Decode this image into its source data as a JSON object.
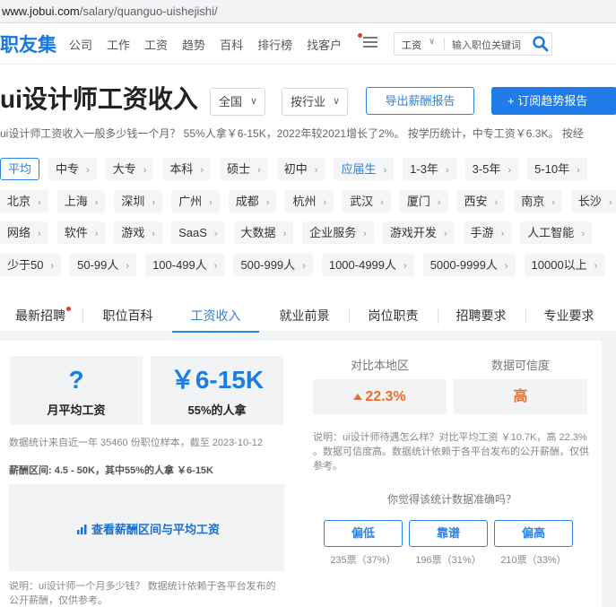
{
  "browser": {
    "url_host": "www.jobui.com",
    "url_path": "/salary/quanguo-uishejishi/"
  },
  "nav": {
    "logo": "职友集",
    "links": [
      "公司",
      "工作",
      "工资",
      "趋势",
      "百科",
      "排行榜",
      "找客户"
    ],
    "search_type": "工资",
    "search_placeholder": "输入职位关键词"
  },
  "header": {
    "title": "ui设计师工资收入",
    "region": "全国",
    "industry": "按行业",
    "export_label": "导出薪酬报告",
    "subscribe_label": "+ 订阅趋势报告",
    "summary": "ui设计师工资收入一般多少钱一个月？ 55%人拿￥6-15K，2022年较2021增长了2%。 按学历统计，中专工资￥6.3K。 按经"
  },
  "filters": {
    "education": [
      {
        "label": "平均",
        "active": true
      },
      {
        "label": "中专"
      },
      {
        "label": "大专"
      },
      {
        "label": "本科"
      },
      {
        "label": "硕士"
      },
      {
        "label": "初中"
      },
      {
        "label": "应届生",
        "highlight": true
      },
      {
        "label": "1-3年"
      },
      {
        "label": "3-5年"
      },
      {
        "label": "5-10年"
      }
    ],
    "cities": [
      "北京",
      "上海",
      "深圳",
      "广州",
      "成都",
      "杭州",
      "武汉",
      "厦门",
      "西安",
      "南京",
      "长沙"
    ],
    "industries": [
      "网络",
      "软件",
      "游戏",
      "SaaS",
      "大数据",
      "企业服务",
      "游戏开发",
      "手游",
      "人工智能"
    ],
    "company_sizes": [
      "少于50",
      "50-99人",
      "100-499人",
      "500-999人",
      "1000-4999人",
      "5000-9999人",
      "10000以上"
    ]
  },
  "tabs": [
    "最新招聘",
    "职位百科",
    "工资收入",
    "就业前景",
    "岗位职责",
    "招聘要求",
    "专业要求"
  ],
  "salary": {
    "avg_value": "?",
    "avg_label": "月平均工资",
    "range_value": "￥6-15K",
    "range_label": "55%的人拿",
    "sample_note": "数据统计来自近一年 35460 份职位样本，截至 2023-10-12",
    "range_line": "薪酬区间: 4.5 - 50K，其中55%的人拿 ￥6-15K",
    "chart_link": "查看薪酬区间与平均工资",
    "bottom_note": "说明：ui设计师一个月多少钱？ 数据统计依赖于各平台发布的公开薪酬，仅供参考。"
  },
  "compare": {
    "label_local": "对比本地区",
    "label_confidence": "数据可信度",
    "local_value": "22.3%",
    "confidence_value": "高",
    "note": "说明：ui设计师待遇怎么样？对比平均工资 ￥10.7K，高 22.3% 。数据可信度高。数据统计依赖于各平台发布的公开薪酬，仅供参考。",
    "question": "你觉得该统计数据准确吗？",
    "votes": [
      {
        "label": "偏低",
        "count": "235票（37%）"
      },
      {
        "label": "靠谱",
        "count": "196票（31%）"
      },
      {
        "label": "偏高",
        "count": "210票（33%）"
      }
    ]
  },
  "colors": {
    "accent": "#2b82e8",
    "primary_button": "#1f7ce8",
    "orange": "#f06d28"
  }
}
